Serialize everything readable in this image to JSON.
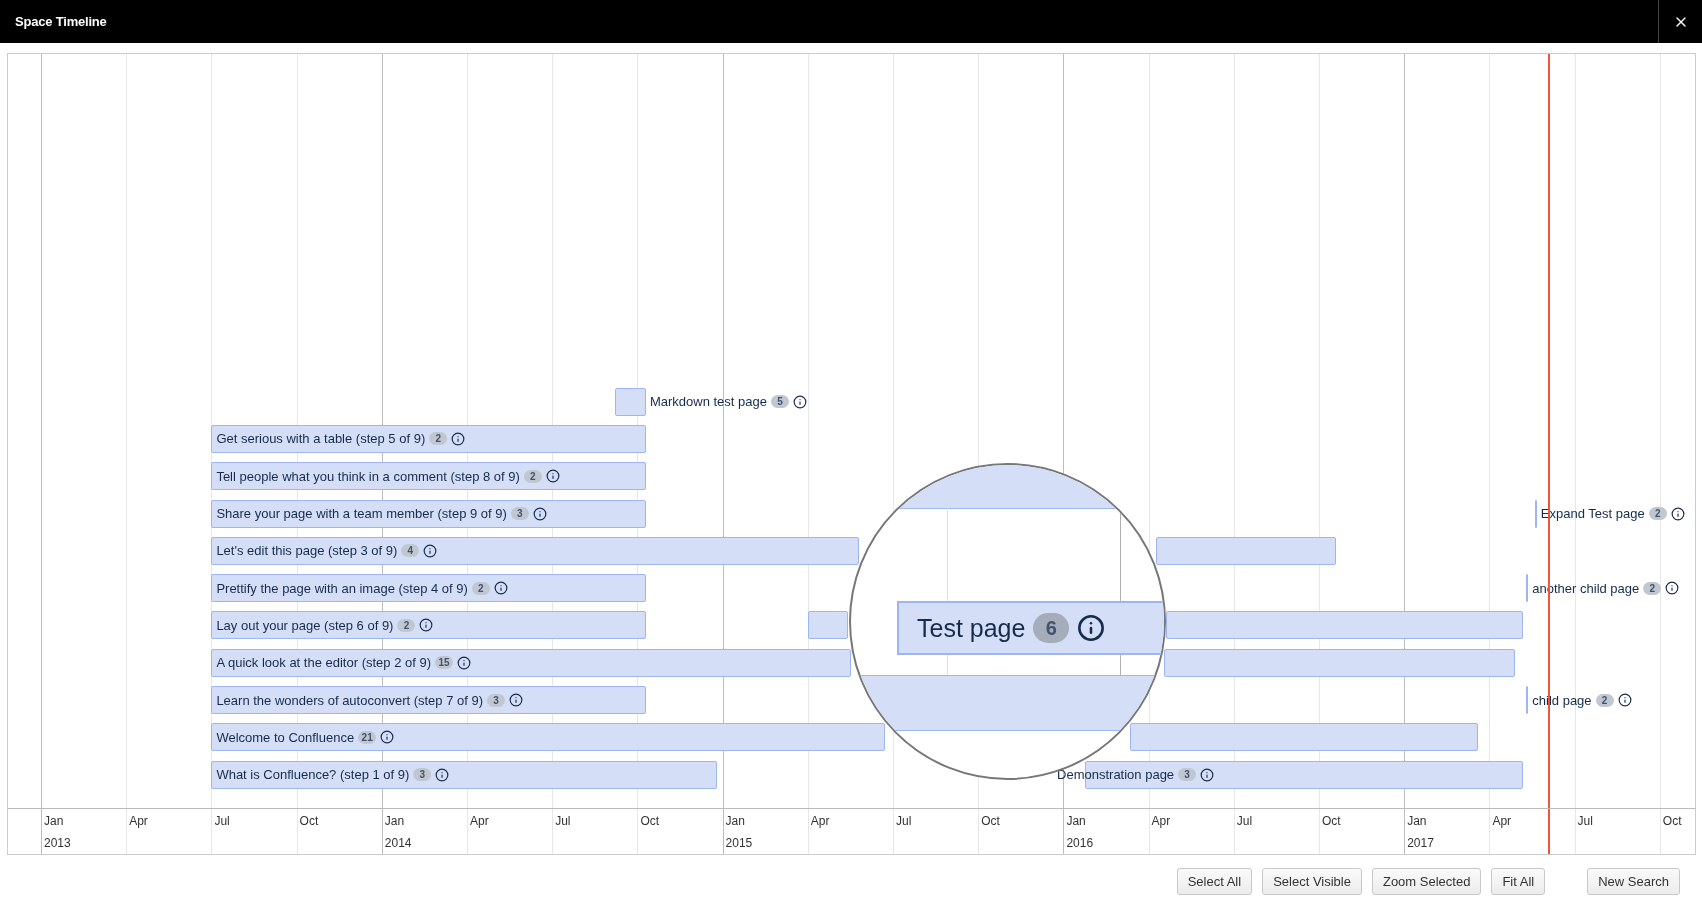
{
  "window": {
    "title": "Space Timeline"
  },
  "timeline": {
    "items": [
      {
        "kind": "marker",
        "label": "Markdown test page",
        "count": "5"
      },
      {
        "kind": "bar",
        "label": "Get serious with a table (step 5 of 9)",
        "count": "2"
      },
      {
        "kind": "bar",
        "label": "Tell people what you think in a comment (step 8 of 9)",
        "count": "2"
      },
      {
        "kind": "bar",
        "label": "Share your page with a team member (step 9 of 9)",
        "count": "3"
      },
      {
        "kind": "marker",
        "label": "Expand Test page",
        "count": "2"
      },
      {
        "kind": "bar",
        "label": "Let's edit this page (step 3 of 9)",
        "count": "4"
      },
      {
        "kind": "bar",
        "label": "Prettify the page with an image (step 4 of 9)",
        "count": "2"
      },
      {
        "kind": "marker",
        "label": "another child page",
        "count": "2"
      },
      {
        "kind": "bar",
        "label": "Lay out your page (step 6 of 9)",
        "count": "2"
      },
      {
        "kind": "bar",
        "label": "A quick look at the editor (step 2 of 9)",
        "count": "15"
      },
      {
        "kind": "bar",
        "label": "Learn the wonders of autoconvert (step 7 of 9)",
        "count": "3"
      },
      {
        "kind": "marker",
        "label": "child page",
        "count": "2"
      },
      {
        "kind": "bar",
        "label": "Welcome to Confluence",
        "count": "21"
      },
      {
        "kind": "bar",
        "label": "What is Confluence? (step 1 of 9)",
        "count": "3"
      },
      {
        "kind": "bar",
        "label": "Demonstration page",
        "count": "3"
      }
    ],
    "magnifier": {
      "label": "Test page",
      "count": "6"
    },
    "axis": {
      "months": [
        "Jan",
        "Apr",
        "Jul",
        "Oct",
        "Jan",
        "Apr",
        "Jul",
        "Oct",
        "Jan",
        "Apr",
        "Jul",
        "Oct",
        "Jan",
        "Apr",
        "Jul",
        "Oct",
        "Jan",
        "Apr",
        "Jul",
        "Oct"
      ],
      "years": [
        "2013",
        "2014",
        "2015",
        "2016",
        "2017"
      ]
    }
  },
  "buttons": [
    {
      "label": "Select All"
    },
    {
      "label": "Select Visible"
    },
    {
      "label": "Zoom Selected"
    },
    {
      "label": "Fit All"
    },
    {
      "label": "New Search",
      "kind": "separate"
    }
  ]
}
